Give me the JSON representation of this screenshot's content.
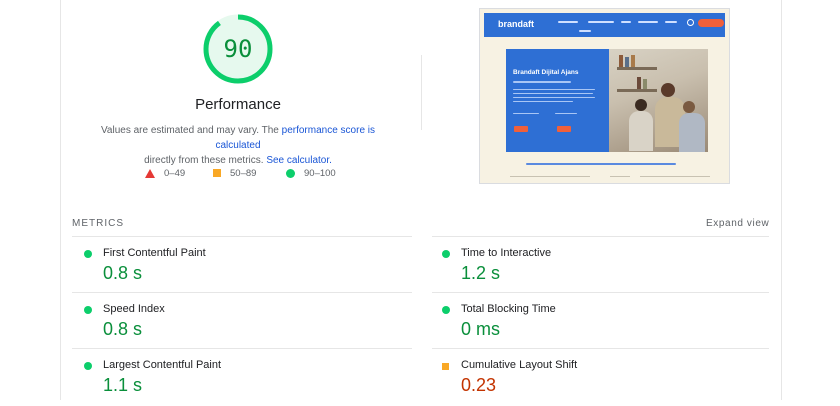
{
  "score": {
    "value": "90",
    "fraction": 0.9,
    "title": "Performance",
    "desc_prefix": "Values are estimated and may vary. The ",
    "desc_link1": "performance score is calculated",
    "desc_middle": " directly from these metrics. ",
    "desc_link2": "See calculator."
  },
  "legend": [
    {
      "icon": "red-triangle-icon",
      "label": "0–49"
    },
    {
      "icon": "orange-square-icon",
      "label": "50–89"
    },
    {
      "icon": "green-circle-icon",
      "label": "90–100"
    }
  ],
  "screenshot": {
    "logo": "brandaft",
    "hero_title": "Brandaft Dijital Ajans"
  },
  "metrics": {
    "heading": "METRICS",
    "expand_label": "Expand view",
    "items": [
      {
        "name": "First Contentful Paint",
        "value": "0.8 s",
        "rating": "good"
      },
      {
        "name": "Time to Interactive",
        "value": "1.2 s",
        "rating": "good"
      },
      {
        "name": "Speed Index",
        "value": "0.8 s",
        "rating": "good"
      },
      {
        "name": "Total Blocking Time",
        "value": "0 ms",
        "rating": "good"
      },
      {
        "name": "Largest Contentful Paint",
        "value": "1.1 s",
        "rating": "good"
      },
      {
        "name": "Cumulative Layout Shift",
        "value": "0.23",
        "rating": "average"
      }
    ]
  },
  "colors": {
    "good": "#0cce6b",
    "good_text": "#0a8f3b",
    "average": "#f9a825",
    "average_text": "#c33300",
    "poor": "#e53935",
    "link": "#1a56d6"
  }
}
